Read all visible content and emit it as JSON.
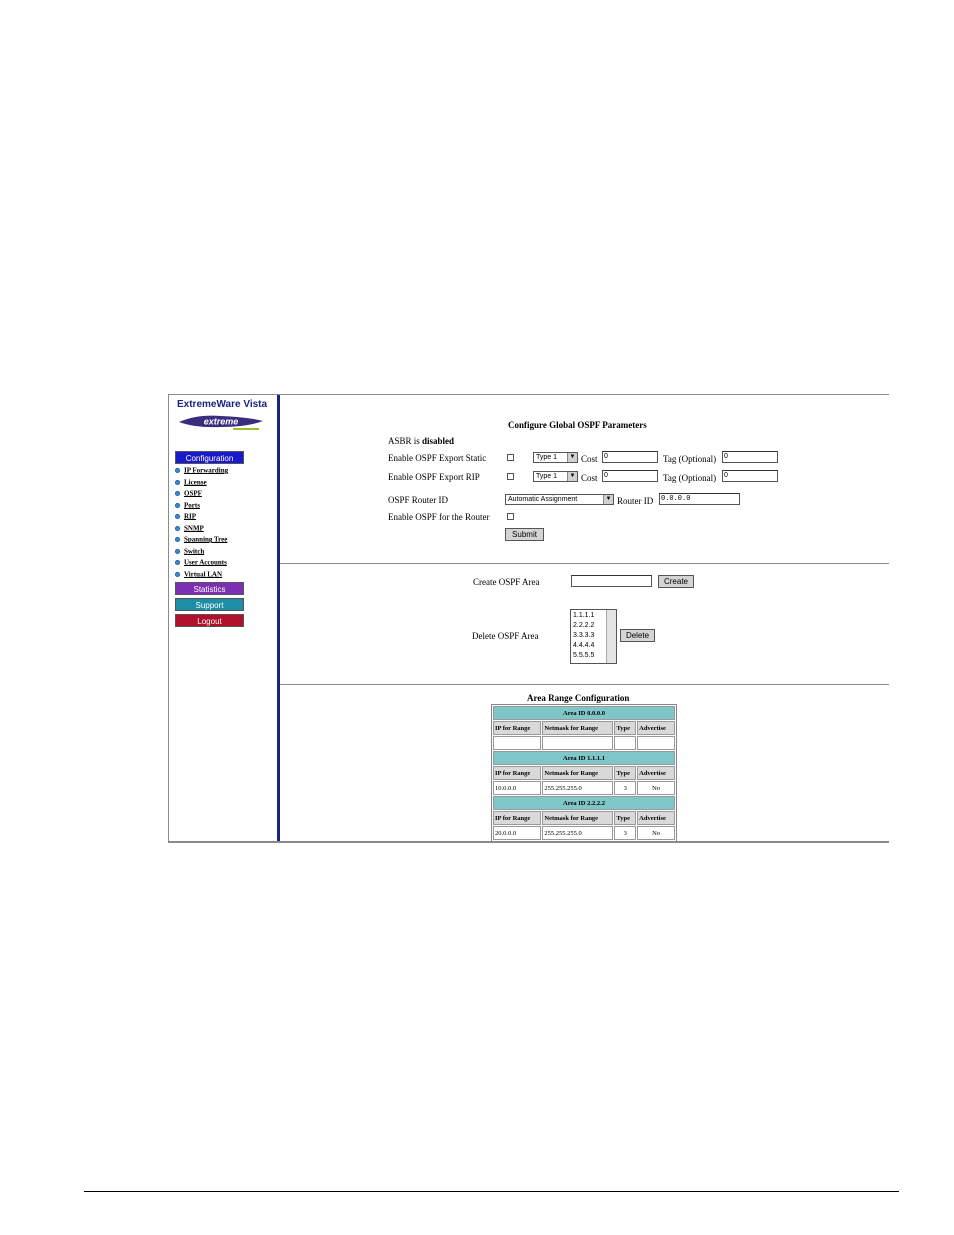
{
  "sidebar": {
    "product_name": "ExtremeWare Vista",
    "logo_icon": "extreme-networks-logo",
    "config_button": "Configuration",
    "nav_items": [
      "IP Forwarding",
      "License",
      "OSPF",
      "Ports",
      "RIP",
      "SNMP",
      "Spanning Tree",
      "Switch",
      "User Accounts",
      "Virtual LAN"
    ],
    "statistics_button": "Statistics",
    "support_button": "Support",
    "logout_button": "Logout",
    "colors": {
      "configuration": "#1a1acc",
      "statistics": "#7b2fb5",
      "support": "#1c8fa6",
      "logout": "#b0102a",
      "divider": "#1a237e"
    }
  },
  "global": {
    "title": "Configure Global OSPF Parameters",
    "asbr_label": "ASBR is",
    "asbr_status": "disabled",
    "export_static": {
      "label": "Enable OSPF Export Static",
      "type": "Type 1",
      "cost_label": "Cost",
      "cost_value": "0",
      "tag_label": "Tag (Optional)",
      "tag_value": "0"
    },
    "export_rip": {
      "label": "Enable OSPF Export RIP",
      "type": "Type 1",
      "cost_label": "Cost",
      "cost_value": "0",
      "tag_label": "Tag (Optional)",
      "tag_value": "0"
    },
    "router_id": {
      "label": "OSPF Router ID",
      "mode": "Automatic Assignment",
      "id_label": "Router ID",
      "id_value": "0.0.0.0"
    },
    "enable_router_label": "Enable OSPF for the Router",
    "submit_label": "Submit"
  },
  "area": {
    "create_label": "Create OSPF Area",
    "create_value": "",
    "create_button": "Create",
    "delete_label": "Delete OSPF Area",
    "areas": [
      "1.1.1.1",
      "2.2.2.2",
      "3.3.3.3",
      "4.4.4.4",
      "5.5.5.5"
    ],
    "delete_button": "Delete"
  },
  "range": {
    "title": "Area Range Configuration",
    "columns": [
      "IP for Range",
      "Netmask for Range",
      "Type",
      "Advertise"
    ],
    "sections": [
      {
        "header": "Area ID 0.0.0.0",
        "row": [
          "",
          "",
          "",
          ""
        ]
      },
      {
        "header": "Area ID 1.1.1.1",
        "row": [
          "10.0.0.0",
          "255.255.255.0",
          "3",
          "No"
        ]
      },
      {
        "header": "Area ID 2.2.2.2",
        "row": [
          "20.0.0.0",
          "255.255.255.0",
          "3",
          "No"
        ]
      }
    ]
  }
}
